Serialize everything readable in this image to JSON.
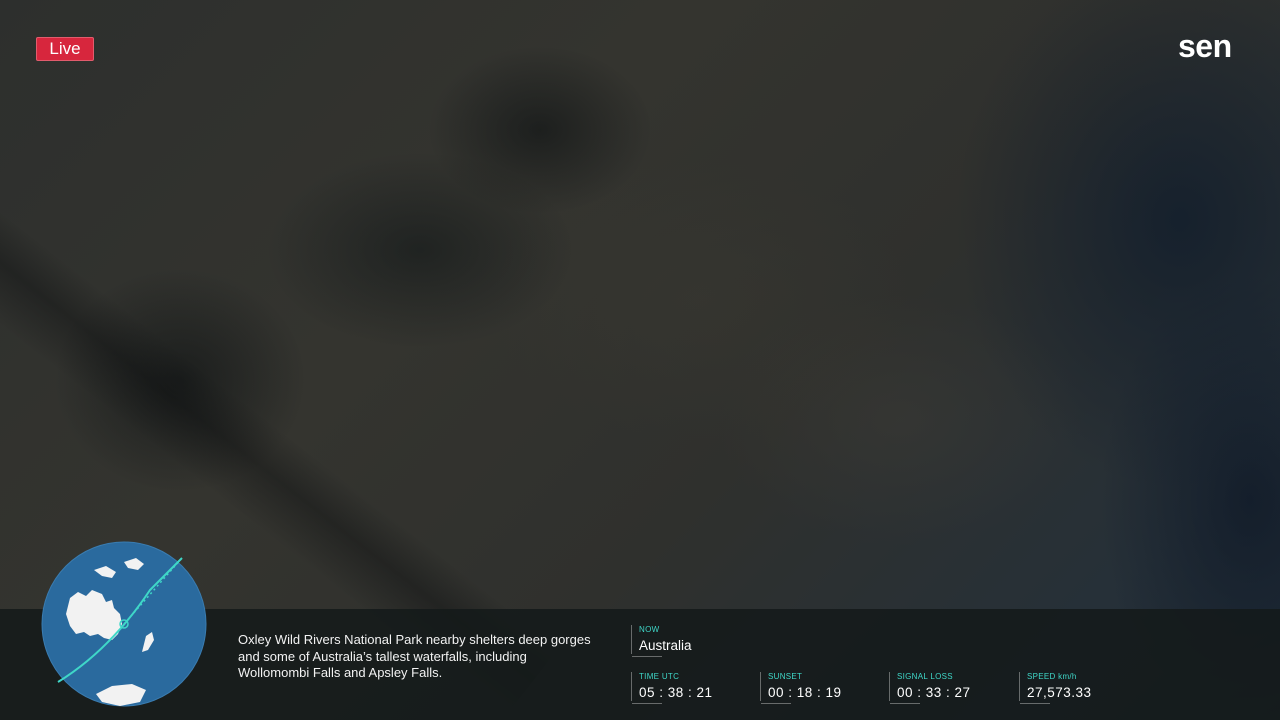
{
  "live_badge": "Live",
  "brand": {
    "logo_text": "sen"
  },
  "caption": "Oxley Wild Rivers National Park nearby shelters deep gorges and some of Australia’s tallest waterfalls, including Wollomombi Falls and Apsley Falls.",
  "now": {
    "label": "NOW",
    "value": "Australia"
  },
  "stats": {
    "time_utc": {
      "label": "TIME UTC",
      "value": "05 : 38 : 21"
    },
    "sunset": {
      "label": "SUNSET",
      "value": "00 : 18 : 19"
    },
    "signal_loss": {
      "label": "SIGNAL LOSS",
      "value": "00 : 33 : 27"
    },
    "speed": {
      "label": "SPEED km/h",
      "value": "27,573.33"
    }
  },
  "colors": {
    "live_red": "#d7263d",
    "accent_teal": "#3fd7c8",
    "globe_ocean": "#2a6a9e",
    "land_white": "#f2f2f2"
  },
  "icons": {
    "globe": "globe-orbit-map-icon"
  }
}
